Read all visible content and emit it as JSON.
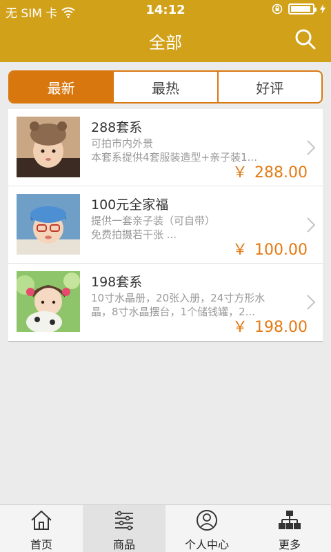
{
  "status": {
    "carrier": "无 SIM 卡",
    "time": "14:12"
  },
  "header": {
    "title": "全部",
    "icons": [
      "search-icon"
    ]
  },
  "segments": [
    {
      "label": "最新",
      "active": true
    },
    {
      "label": "最热",
      "active": false
    },
    {
      "label": "好评",
      "active": false
    }
  ],
  "products": [
    {
      "title": "288套系",
      "desc_line1": "可拍市内外景",
      "desc_line2": "本套系提供4套服装造型+亲子装1...",
      "currency": "￥",
      "price": "288.00"
    },
    {
      "title": "100元全家福",
      "desc_line1": "提供一套亲子装（可自带）",
      "desc_line2": "免费拍摄若干张 ...",
      "currency": "￥",
      "price": "100.00"
    },
    {
      "title": "198套系",
      "desc_line1": "10寸水晶册，20张入册，24寸方形水",
      "desc_line2": "晶，8寸水晶摆台，1个储钱罐，2...",
      "currency": "￥",
      "price": "198.00"
    }
  ],
  "tabbar": [
    {
      "label": "首页",
      "icon": "home-icon",
      "active": false
    },
    {
      "label": "商品",
      "icon": "list-icon",
      "active": true
    },
    {
      "label": "个人中心",
      "icon": "user-icon",
      "active": false
    },
    {
      "label": "更多",
      "icon": "sitemap-icon",
      "active": false
    }
  ],
  "colors": {
    "header": "#d2a11a",
    "accent": "#d9770f",
    "price": "#e47a13"
  }
}
